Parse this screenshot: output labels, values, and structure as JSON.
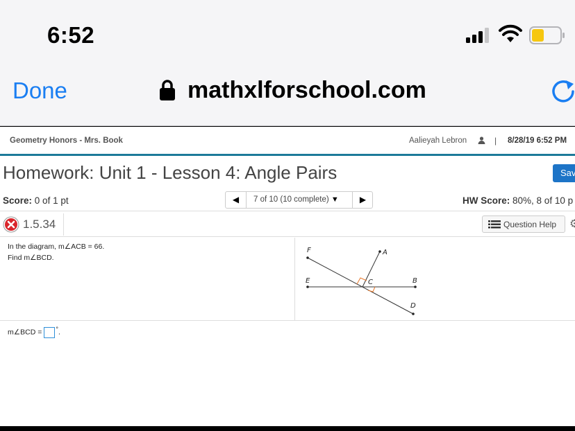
{
  "status": {
    "time": "6:52"
  },
  "browser": {
    "done_label": "Done",
    "url": "mathxlforschool.com"
  },
  "header": {
    "course": "Geometry Honors - Mrs. Book",
    "user": "Aalieyah Lebron",
    "separator": "|",
    "datetime": "8/28/19 6:52 PM"
  },
  "homework": {
    "title": "Homework: Unit 1 - Lesson 4: Angle Pairs",
    "save_label": "Sav"
  },
  "score_row": {
    "score_label": "Score:",
    "score_value": "0 of 1 pt",
    "pager_label": "7 of 10 (10 complete)",
    "hw_score_label": "HW Score:",
    "hw_score_value": "80%, 8 of 10 p"
  },
  "question": {
    "number": "1.5.34",
    "help_label": "Question Help",
    "status": "incorrect"
  },
  "problem": {
    "line1": "In the diagram, m∠ACB = 66.",
    "line2": "Find m∠BCD.",
    "answer_prefix": "m∠BCD =",
    "answer_value": "",
    "answer_suffix": "°",
    "answer_end": "."
  },
  "diagram": {
    "labels": {
      "F": "F",
      "A": "A",
      "E": "E",
      "C": "C",
      "B": "B",
      "D": "D"
    }
  },
  "colors": {
    "accent_blue": "#1a7ef2",
    "teal_rule": "#1c7a99",
    "save_blue": "#1d74c7",
    "error_red": "#d9262c",
    "right_angle": "#e8782a"
  }
}
